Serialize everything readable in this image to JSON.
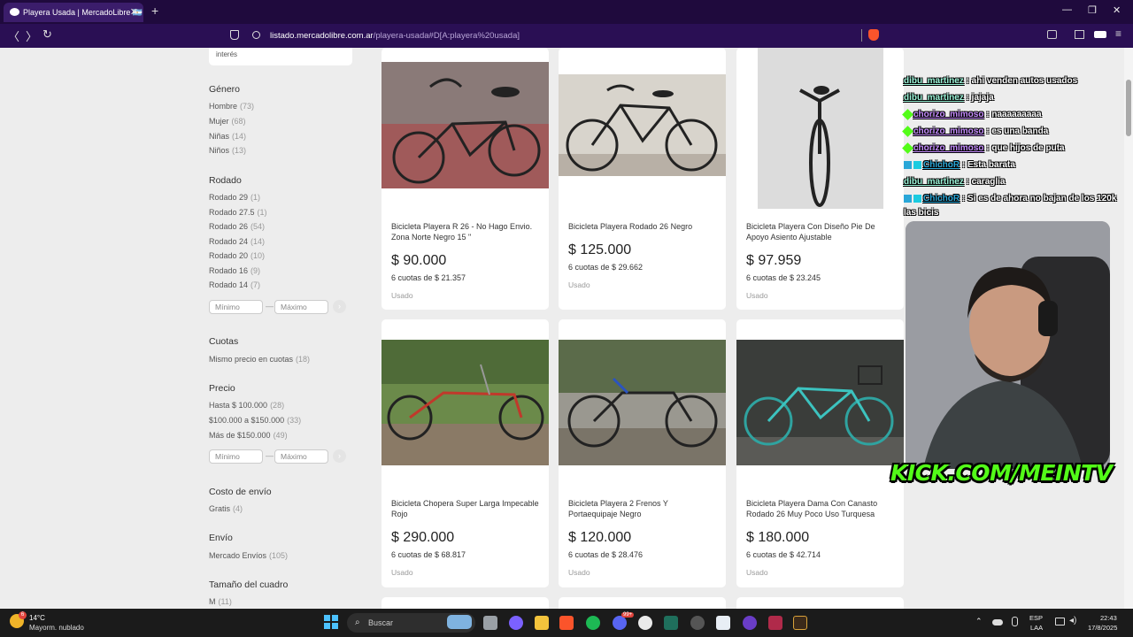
{
  "browser": {
    "tab_title": "Playera Usada | MercadoLibre 🇦🇷",
    "new_tab": "+",
    "url_domain": "listado.mercadolibre.com.ar",
    "url_path": "/playera-usada#D[A:playera%20usada]"
  },
  "sidebar": {
    "search_hint": "interés",
    "genero": {
      "title": "Género",
      "items": [
        {
          "label": "Hombre",
          "count": "(73)"
        },
        {
          "label": "Mujer",
          "count": "(68)"
        },
        {
          "label": "Niñas",
          "count": "(14)"
        },
        {
          "label": "Niños",
          "count": "(13)"
        }
      ]
    },
    "rodado": {
      "title": "Rodado",
      "items": [
        {
          "label": "Rodado 29",
          "count": "(1)"
        },
        {
          "label": "Rodado 27.5",
          "count": "(1)"
        },
        {
          "label": "Rodado 26",
          "count": "(54)"
        },
        {
          "label": "Rodado 24",
          "count": "(14)"
        },
        {
          "label": "Rodado 20",
          "count": "(10)"
        },
        {
          "label": "Rodado 16",
          "count": "(9)"
        },
        {
          "label": "Rodado 14",
          "count": "(7)"
        }
      ],
      "min_placeholder": "Mínimo",
      "max_placeholder": "Máximo"
    },
    "cuotas": {
      "title": "Cuotas",
      "items": [
        {
          "label": "Mismo precio en cuotas",
          "count": "(18)"
        }
      ]
    },
    "precio": {
      "title": "Precio",
      "items": [
        {
          "label": "Hasta $ 100.000",
          "count": "(28)"
        },
        {
          "label": "$100.000 a $150.000",
          "count": "(33)"
        },
        {
          "label": "Más de $150.000",
          "count": "(49)"
        }
      ],
      "min_placeholder": "Mínimo",
      "max_placeholder": "Máximo"
    },
    "envio_costo": {
      "title": "Costo de envío",
      "items": [
        {
          "label": "Gratis",
          "count": "(4)"
        }
      ]
    },
    "envio": {
      "title": "Envío",
      "items": [
        {
          "label": "Mercado Envíos",
          "count": "(105)"
        }
      ]
    },
    "cuadro": {
      "title": "Tamaño del cuadro",
      "items": [
        {
          "label": "M",
          "count": "(11)"
        }
      ]
    }
  },
  "products": [
    {
      "title": "Bicicleta Playera R 26 - No Hago Envio. Zona Norte Negro 15 \"",
      "price": "$ 90.000",
      "cuotas": "6 cuotas de $ 21.357",
      "condition": "Usado"
    },
    {
      "title": "Bicicleta Playera Rodado 26 Negro",
      "price": "$ 125.000",
      "cuotas": "6 cuotas de $ 29.662",
      "condition": "Usado"
    },
    {
      "title": "Bicicleta Playera Con Diseño Pie De Apoyo Asiento Ajustable",
      "price": "$ 97.959",
      "cuotas": "6 cuotas de $ 23.245",
      "condition": "Usado"
    },
    {
      "title": "Bicicleta Chopera Super Larga Impecable Rojo",
      "price": "$ 290.000",
      "cuotas": "6 cuotas de $ 68.817",
      "condition": "Usado"
    },
    {
      "title": "Bicicleta Playera 2 Frenos Y Portaequipaje Negro",
      "price": "$ 120.000",
      "cuotas": "6 cuotas de $ 28.476",
      "condition": "Usado"
    },
    {
      "title": "Bicicleta Playera Dama Con Canasto Rodado 26 Muy Poco Uso Turquesa",
      "price": "$ 180.000",
      "cuotas": "6 cuotas de $ 42.714",
      "condition": "Usado"
    }
  ],
  "chat": [
    {
      "user": "dibu_martinez",
      "msg": ": ahi venden autos usados",
      "color": "#9cf5d9"
    },
    {
      "user": "dibu_martinez",
      "msg": ": jajaja",
      "color": "#9cf5d9"
    },
    {
      "user": "chorizo_mimoso",
      "msg": ": naaaaaaaaa",
      "color": "#c68cff"
    },
    {
      "user": "chorizo_mimoso",
      "msg": ": es una banda",
      "color": "#c68cff"
    },
    {
      "user": "chorizo_mimoso",
      "msg": ": que hijos de puta",
      "color": "#c68cff"
    },
    {
      "user": "ChichoR",
      "msg": ": Esta barata",
      "color": "#2aa7d8"
    },
    {
      "user": "dibu_martinez",
      "msg": ": caraglia",
      "color": "#9cf5d9"
    },
    {
      "user": "ChichoR",
      "msg": ": Si es de ahora no bajan de los 120k",
      "color": "#2aa7d8"
    },
    {
      "user": "",
      "msg": "las bicis",
      "color": "#ffffff"
    }
  ],
  "overlay": {
    "kick": "KICK.COM/MEINTV"
  },
  "taskbar": {
    "temp": "14°C",
    "weather": "Mayorm. nublado",
    "search": "Buscar",
    "lang1": "ESP",
    "lang2": "LAA",
    "time": "22:43",
    "date": "17/8/2025",
    "notif": "6",
    "notif_badge": "99+"
  }
}
